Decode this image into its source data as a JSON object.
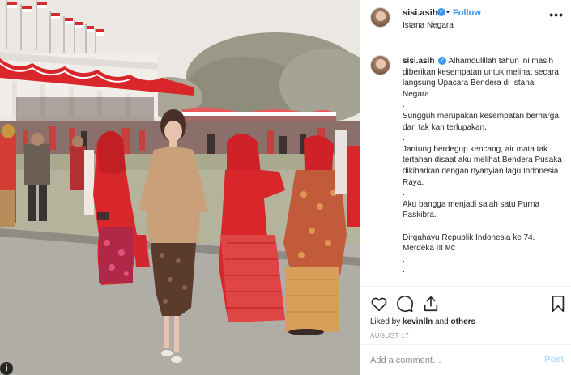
{
  "post": {
    "username": "sisi.asih",
    "verified_icon": "verified-badge-icon",
    "dot": "•",
    "follow_label": "Follow",
    "location": "Istana Negara",
    "more_icon": "•••"
  },
  "caption": {
    "username": "sisi.asih",
    "lines": [
      "Alhamdulillah tahun ini masih diberikan kesempatan untuk melihat secara langsung Upacara Bendera di Istana Negara.",
      ".",
      "Sungguh merupakan kesempatan berharga, dan tak kan terlupakan.",
      ".",
      "Jantung berdegup kencang, air mata tak tertahan disaat aku melihat Bendera Pusaka dikibarkan dengan nyanyian lagu Indonesia Raya.",
      ".",
      "Aku bangga menjadi salah satu Purna Paskibra.",
      ".",
      "Dirgahayu Republik Indonesia ke 74. Merdeka !!!",
      ".",
      "."
    ],
    "emoji_mc": "MC"
  },
  "actions": {
    "like_icon": "heart-icon",
    "comment_icon": "comment-icon",
    "share_icon": "share-icon",
    "save_icon": "bookmark-icon",
    "likes_prefix": "Liked by",
    "likes_user": "kevinlln",
    "likes_and": "and",
    "likes_others": "others",
    "date": "AUGUST 17"
  },
  "comment_box": {
    "placeholder": "Add a comment…",
    "post_label": "Post"
  },
  "photo": {
    "info_icon": "i"
  },
  "colors": {
    "link_blue": "#3897f0",
    "post_disabled": "#b2dffc",
    "kebaya_red": "#d9262b",
    "kebaya_gold": "#c9a07a"
  }
}
